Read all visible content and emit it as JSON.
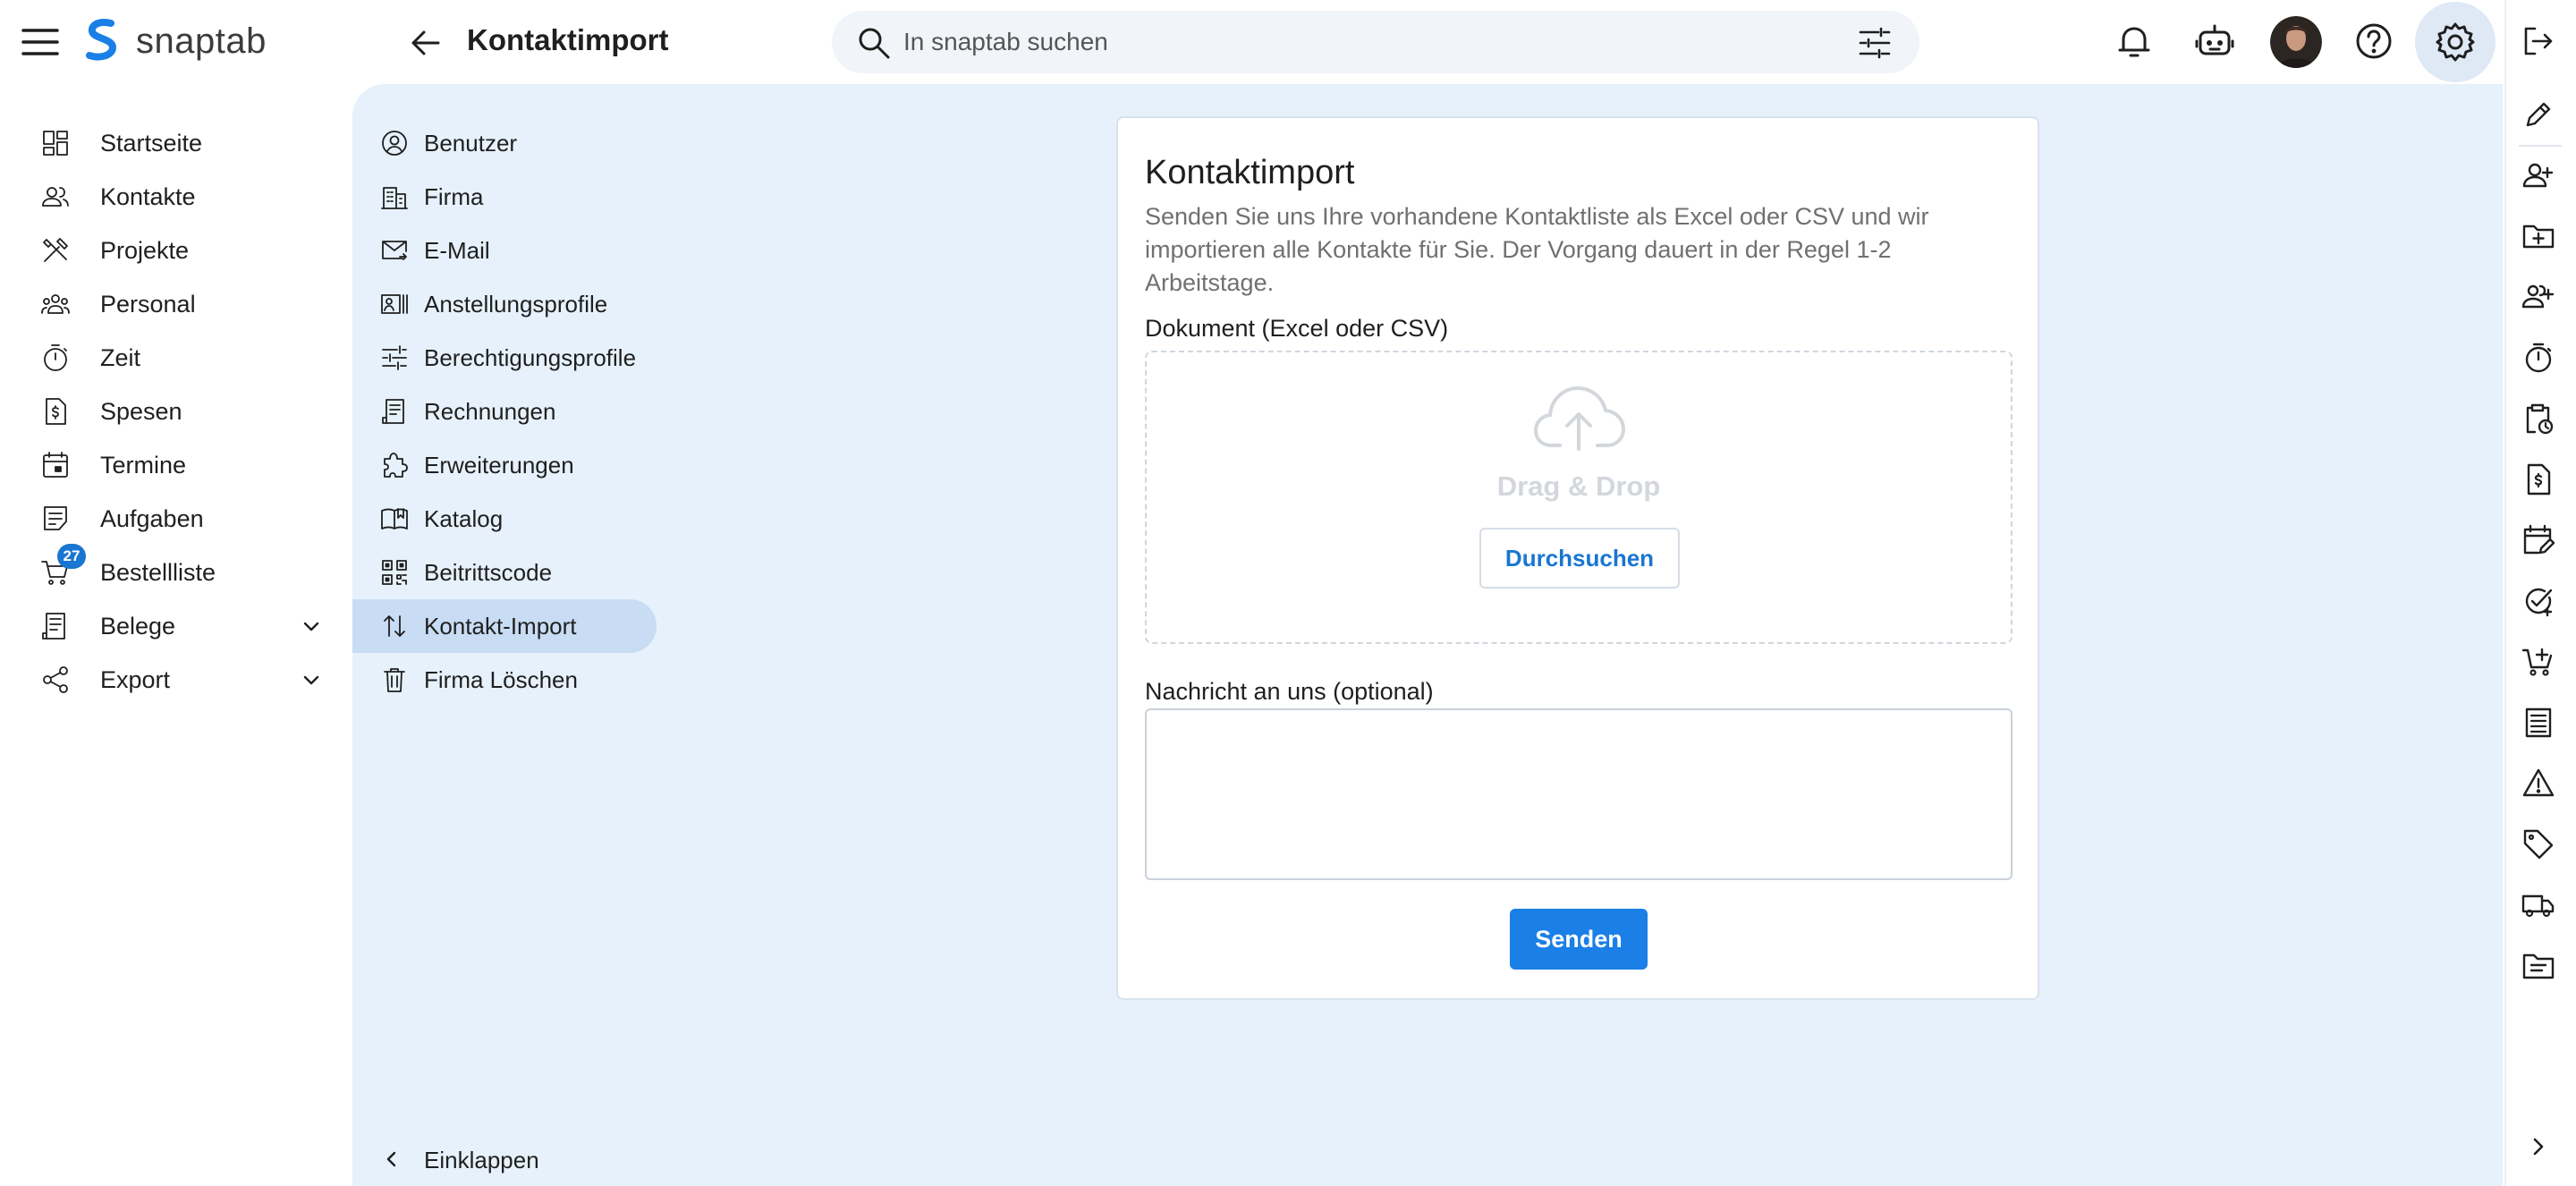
{
  "app": {
    "name": "snaptab"
  },
  "header": {
    "title": "Kontaktimport",
    "search_placeholder": "In snaptab suchen"
  },
  "sidebar": {
    "items": [
      {
        "label": "Startseite",
        "icon": "dashboard-icon"
      },
      {
        "label": "Kontakte",
        "icon": "contacts-icon"
      },
      {
        "label": "Projekte",
        "icon": "tools-icon"
      },
      {
        "label": "Personal",
        "icon": "staff-icon"
      },
      {
        "label": "Zeit",
        "icon": "timer-icon"
      },
      {
        "label": "Spesen",
        "icon": "expense-icon"
      },
      {
        "label": "Termine",
        "icon": "calendar-icon"
      },
      {
        "label": "Aufgaben",
        "icon": "task-icon"
      },
      {
        "label": "Bestellliste",
        "icon": "cart-icon",
        "badge": "27"
      },
      {
        "label": "Belege",
        "icon": "receipt-icon",
        "expandable": true
      },
      {
        "label": "Export",
        "icon": "share-icon",
        "expandable": true
      }
    ]
  },
  "settings_nav": {
    "items": [
      {
        "label": "Benutzer",
        "icon": "user-circle-icon"
      },
      {
        "label": "Firma",
        "icon": "building-icon"
      },
      {
        "label": "E-Mail",
        "icon": "mail-icon"
      },
      {
        "label": "Anstellungsprofile",
        "icon": "id-card-icon"
      },
      {
        "label": "Berechtigungsprofile",
        "icon": "tune-icon"
      },
      {
        "label": "Rechnungen",
        "icon": "invoice-icon"
      },
      {
        "label": "Erweiterungen",
        "icon": "extension-icon"
      },
      {
        "label": "Katalog",
        "icon": "book-icon"
      },
      {
        "label": "Beitrittscode",
        "icon": "qr-code-icon"
      },
      {
        "label": "Kontakt-Import",
        "icon": "import-arrows-icon",
        "active": true
      },
      {
        "label": "Firma Löschen",
        "icon": "trash-icon"
      }
    ],
    "collapse_label": "Einklappen"
  },
  "card": {
    "title": "Kontaktimport",
    "description": "Senden Sie uns Ihre vorhandene Kontaktliste als Excel oder CSV und wir importieren alle Kontakte für Sie. Der Vorgang dauert in der Regel 1-2 Arbeitstage.",
    "document_label": "Dokument (Excel oder CSV)",
    "dropzone_text": "Drag & Drop",
    "browse_label": "Durchsuchen",
    "message_label": "Nachricht an uns (optional)",
    "message_value": "",
    "send_label": "Senden"
  },
  "colors": {
    "accent": "#1a7fe6",
    "main_bg": "#e6f1fb",
    "active_item": "#c8dcf4",
    "badge": "#1976d2"
  }
}
